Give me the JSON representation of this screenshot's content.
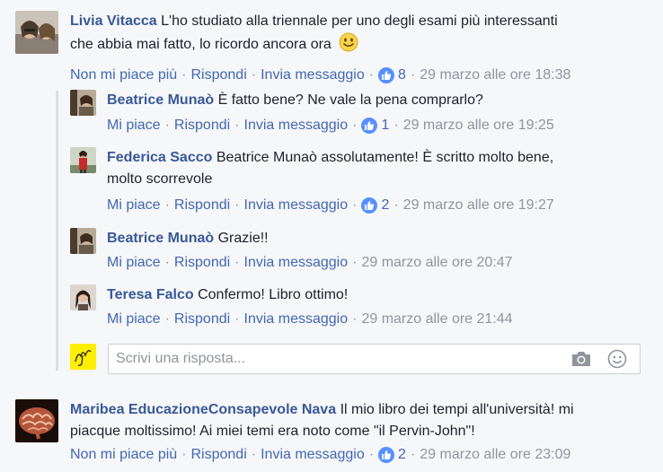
{
  "actions": {
    "unlike": "Non mi piace più",
    "like": "Mi piace",
    "reply": "Rispondi",
    "message": "Invia messaggio"
  },
  "comments": [
    {
      "author": "Livia Vitacca",
      "text_line1": "L'ho studiato alla triennale per uno degli esami più interessanti",
      "text_line2": "che abbia mai fatto, lo ricordo ancora ora",
      "likes": "8",
      "timestamp": "29 marzo alle ore 18:38"
    },
    {
      "author": "Maribea EducazioneConsapevole Nava",
      "text_line1": "Il mio libro dei tempi all'università! mi",
      "text_line2": "piacque moltissimo! Ai miei temi era noto come \"il Pervin-John\"!",
      "likes": "2",
      "timestamp": "29 marzo alle ore 23:09"
    }
  ],
  "replies": [
    {
      "author": "Beatrice Munaò",
      "text_line1": "È fatto bene? Ne vale la pena comprarlo?",
      "likes": "1",
      "timestamp": "29 marzo alle ore 19:25"
    },
    {
      "author": "Federica Sacco",
      "text_line1": "Beatrice Munaò assolutamente! È scritto molto bene,",
      "text_line2": "molto scorrevole",
      "likes": "2",
      "timestamp": "29 marzo alle ore 19:27"
    },
    {
      "author": "Beatrice Munaò",
      "text_line1": "Grazie!!",
      "timestamp": "29 marzo alle ore 20:47"
    },
    {
      "author": "Teresa Falco",
      "text_line1": "Confermo! Libro ottimo!",
      "timestamp": "29 marzo alle ore 21:44"
    }
  ],
  "reply_input": {
    "placeholder": "Scrivi una risposta..."
  },
  "colors": {
    "name": "#385898",
    "link": "#4267b2",
    "meta": "#90949c",
    "like_badge": "#5890ff"
  }
}
